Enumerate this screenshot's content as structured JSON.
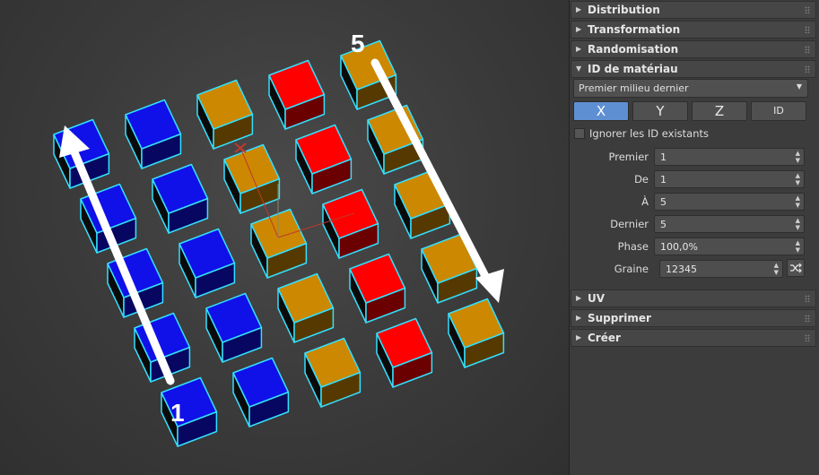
{
  "viewport": {
    "markers": {
      "start": "1",
      "end": "5"
    },
    "colors": {
      "blue": "#1010e8",
      "red": "#ff0000",
      "orange": "#cc8800",
      "outline": "#33e0ff"
    }
  },
  "panel": {
    "rollouts_top": [
      {
        "label": "Distribution",
        "state": "collapsed"
      },
      {
        "label": "Transformation",
        "state": "collapsed"
      },
      {
        "label": "Randomisation",
        "state": "collapsed"
      },
      {
        "label": "ID de matériau",
        "state": "expanded"
      }
    ],
    "material_id": {
      "mode_dropdown": "Premier milieu dernier",
      "axis_buttons": [
        {
          "label": "X",
          "active": true
        },
        {
          "label": "Y",
          "active": false
        },
        {
          "label": "Z",
          "active": false
        },
        {
          "label": "ID",
          "active": false
        }
      ],
      "ignore_existing": {
        "label": "Ignorer les ID existants",
        "checked": false
      },
      "fields": [
        {
          "label": "Premier",
          "value": "1"
        },
        {
          "label": "De",
          "value": "1"
        },
        {
          "label": "À",
          "value": "5"
        },
        {
          "label": "Dernier",
          "value": "5"
        },
        {
          "label": "Phase",
          "value": "100,0%"
        },
        {
          "label": "Graine",
          "value": "12345"
        }
      ]
    },
    "rollouts_bottom": [
      {
        "label": "UV",
        "state": "collapsed"
      },
      {
        "label": "Supprimer",
        "state": "collapsed"
      },
      {
        "label": "Créer",
        "state": "collapsed"
      }
    ]
  }
}
